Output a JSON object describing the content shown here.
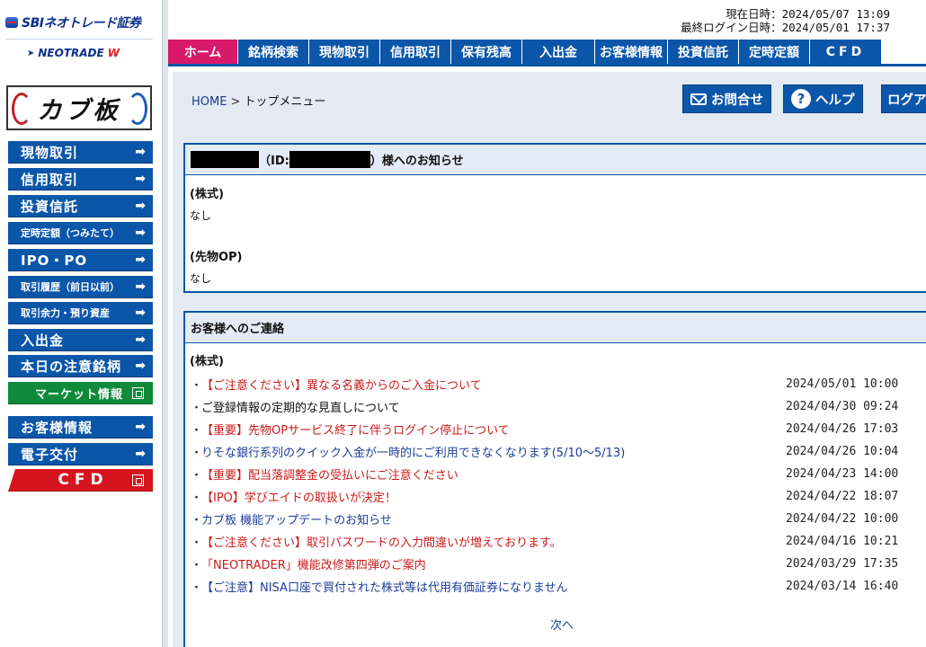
{
  "brand": {
    "sbi": "SBIネオトレード証券",
    "neotrade": "NEOTRADE",
    "neotrade_w": "W",
    "kabuita": "カブ板"
  },
  "header": {
    "now_label": "現在日時：",
    "now_value": "2024/05/07 13:09",
    "last_login_label": "最終ログイン日時：",
    "last_login_value": "2024/05/01 17:37"
  },
  "nav": [
    "ホーム",
    "銘柄検索",
    "現物取引",
    "信用取引",
    "保有残高",
    "入出金",
    "お客様情報",
    "投資信託",
    "定時定額",
    "CFD"
  ],
  "sidebar": {
    "items": [
      {
        "label": "現物取引"
      },
      {
        "label": "信用取引"
      },
      {
        "label": "投資信託"
      },
      {
        "label": "定時定額（つみたて）"
      },
      {
        "label": "IPO・PO"
      },
      {
        "label": "取引履歴（前日以前）"
      },
      {
        "label": "取引余力・預り資産"
      },
      {
        "label": "入出金"
      },
      {
        "label": "本日の注意銘柄"
      },
      {
        "label": "マーケット情報"
      },
      {
        "label": "お客様情報"
      },
      {
        "label": "電子交付"
      },
      {
        "label": "CFD"
      }
    ]
  },
  "topbar": {
    "breadcrumb_home": "HOME",
    "breadcrumb_sep": ">",
    "breadcrumb_current": "トップメニュー",
    "inquiry": "お問合せ",
    "help": "ヘルプ",
    "logout": "ログアウト"
  },
  "notice": {
    "id_label": "（ID:",
    "title_suffix": "）様へのお知らせ",
    "stock_title": "(株式)",
    "stock_body": "なし",
    "futures_title": "(先物OP)",
    "futures_body": "なし"
  },
  "contact": {
    "title": "お客様へのご連絡",
    "section": "(株式)",
    "bullet": "・",
    "messages": [
      {
        "title": "【ご注意ください】異なる名義からのご入金について",
        "date": "2024/05/01 10:00",
        "color": "red"
      },
      {
        "title": "ご登録情報の定期的な見直しについて",
        "date": "2024/04/30 09:24",
        "color": "black"
      },
      {
        "title": "【重要】先物OPサービス終了に伴うログイン停止について",
        "date": "2024/04/26 17:03",
        "color": "red"
      },
      {
        "title": "りそな銀行系列のクイック入金が一時的にご利用できなくなります(5/10～5/13)",
        "date": "2024/04/26 10:04",
        "color": "blue"
      },
      {
        "title": "【重要】配当落調整金の受払いにご注意ください",
        "date": "2024/04/23 14:00",
        "color": "red"
      },
      {
        "title": "【IPO】学びエイドの取扱いが決定！",
        "date": "2024/04/22 18:07",
        "color": "red"
      },
      {
        "title": "カブ板 機能アップデートのお知らせ",
        "date": "2024/04/22 10:00",
        "color": "blue"
      },
      {
        "title": "【ご注意ください】取引パスワードの入力間違いが増えております。",
        "date": "2024/04/16 10:21",
        "color": "red"
      },
      {
        "title": "「NEOTRADER」機能改修第四弾のご案内",
        "date": "2024/03/29 17:35",
        "color": "red"
      },
      {
        "title": "【ご注意】NISA口座で買付された株式等は代用有価証券になりません",
        "date": "2024/03/14 16:40",
        "color": "blue"
      }
    ],
    "next": "次へ"
  },
  "colors": {
    "primary_blue": "#0b56a9",
    "home_tab": "#d8196a",
    "green": "#0f8a3a",
    "red": "#d7141e",
    "panel_bg": "#e3eaf2"
  }
}
